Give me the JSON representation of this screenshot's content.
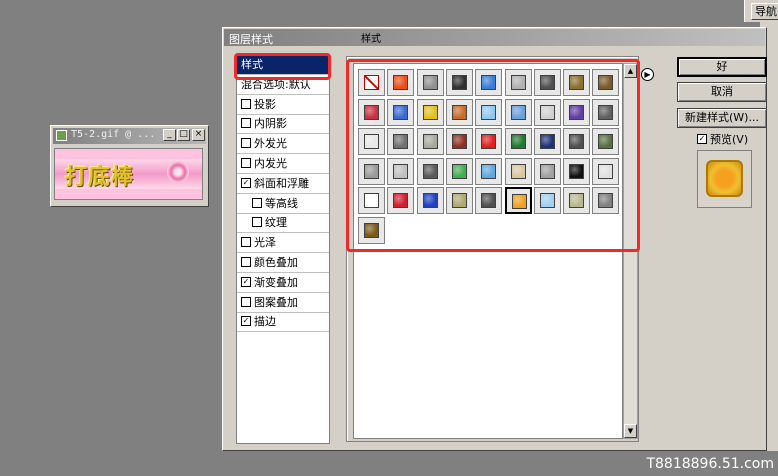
{
  "nav": {
    "tab_label": "导航"
  },
  "doc_window": {
    "title": "T5-2.gif @ ...",
    "canvas_text": "打底棒",
    "buttons": {
      "minimize": "_",
      "maximize": "□",
      "close": "×"
    }
  },
  "dialog": {
    "title": "图层样式",
    "styles_label": "样式",
    "effects": [
      {
        "label": "样式",
        "selected": true,
        "checkbox": false,
        "checked": false,
        "sub": false
      },
      {
        "label": "混合选项:默认",
        "selected": false,
        "checkbox": false,
        "checked": false,
        "sub": false
      },
      {
        "label": "投影",
        "selected": false,
        "checkbox": true,
        "checked": false,
        "sub": false
      },
      {
        "label": "内阴影",
        "selected": false,
        "checkbox": true,
        "checked": false,
        "sub": false
      },
      {
        "label": "外发光",
        "selected": false,
        "checkbox": true,
        "checked": false,
        "sub": false
      },
      {
        "label": "内发光",
        "selected": false,
        "checkbox": true,
        "checked": false,
        "sub": false
      },
      {
        "label": "斜面和浮雕",
        "selected": false,
        "checkbox": true,
        "checked": true,
        "sub": false
      },
      {
        "label": "等高线",
        "selected": false,
        "checkbox": true,
        "checked": false,
        "sub": true
      },
      {
        "label": "纹理",
        "selected": false,
        "checkbox": true,
        "checked": false,
        "sub": true
      },
      {
        "label": "光泽",
        "selected": false,
        "checkbox": true,
        "checked": false,
        "sub": false
      },
      {
        "label": "颜色叠加",
        "selected": false,
        "checkbox": true,
        "checked": false,
        "sub": false
      },
      {
        "label": "渐变叠加",
        "selected": false,
        "checkbox": true,
        "checked": true,
        "sub": false
      },
      {
        "label": "图案叠加",
        "selected": false,
        "checkbox": true,
        "checked": false,
        "sub": false
      },
      {
        "label": "描边",
        "selected": false,
        "checkbox": true,
        "checked": true,
        "sub": false
      }
    ],
    "swatches": [
      {
        "name": "none-style-swatch",
        "fill": "#ffffff",
        "border": "#c00000",
        "none": true
      },
      {
        "name": "orange-glow-swatch",
        "fill": "#e8501a"
      },
      {
        "name": "gray-bevel-swatch",
        "fill": "#909090"
      },
      {
        "name": "black-chrome-swatch",
        "fill": "#303030"
      },
      {
        "name": "blue-glass-swatch",
        "fill": "#3a7ed8"
      },
      {
        "name": "silver-swatch",
        "fill": "#b0b0b0"
      },
      {
        "name": "dark-metal-swatch",
        "fill": "#505050"
      },
      {
        "name": "olive-swatch",
        "fill": "#8a7030"
      },
      {
        "name": "bronze-swatch",
        "fill": "#7a5a28"
      },
      {
        "name": "red-bevel-swatch",
        "fill": "#c83040"
      },
      {
        "name": "multicolor-swatch",
        "fill": "#3a6ad0"
      },
      {
        "name": "yellow-button-swatch",
        "fill": "#e0c020"
      },
      {
        "name": "copper-swatch",
        "fill": "#c86a28"
      },
      {
        "name": "sky-swatch",
        "fill": "#90c8f0"
      },
      {
        "name": "landscape-swatch",
        "fill": "#6aa0d8"
      },
      {
        "name": "noise-swatch",
        "fill": "#d0d0d0"
      },
      {
        "name": "purple-swatch",
        "fill": "#6040a0"
      },
      {
        "name": "dark-gray-swatch",
        "fill": "#606060"
      },
      {
        "name": "light-bevel-swatch",
        "fill": "#e8e8e8"
      },
      {
        "name": "slate-swatch",
        "fill": "#707070"
      },
      {
        "name": "stone-swatch",
        "fill": "#a8a8a0"
      },
      {
        "name": "rust-swatch",
        "fill": "#903020"
      },
      {
        "name": "bright-red-swatch",
        "fill": "#e02020"
      },
      {
        "name": "green-swatch",
        "fill": "#207a30"
      },
      {
        "name": "navy-swatch",
        "fill": "#20307a"
      },
      {
        "name": "checker-swatch",
        "fill": "#505050"
      },
      {
        "name": "moss-swatch",
        "fill": "#5a7040"
      },
      {
        "name": "pewter-swatch",
        "fill": "#9a9a9a"
      },
      {
        "name": "barcode-swatch",
        "fill": "#c0c0c0"
      },
      {
        "name": "graphite-swatch",
        "fill": "#5a5a5a"
      },
      {
        "name": "emerald-swatch",
        "fill": "#40b050"
      },
      {
        "name": "aqua-swatch",
        "fill": "#60a8e0"
      },
      {
        "name": "sand-swatch",
        "fill": "#d8c8a0"
      },
      {
        "name": "ash-swatch",
        "fill": "#a0a0a0"
      },
      {
        "name": "black-swatch",
        "fill": "#101010"
      },
      {
        "name": "sketch-swatch",
        "fill": "#e0e0e0"
      },
      {
        "name": "white-outline-swatch",
        "fill": "#ffffff"
      },
      {
        "name": "crimson-swatch",
        "fill": "#d02030"
      },
      {
        "name": "cobalt-swatch",
        "fill": "#2040c0"
      },
      {
        "name": "khaki-swatch",
        "fill": "#b0a870"
      },
      {
        "name": "charcoal-swatch",
        "fill": "#505050"
      },
      {
        "name": "gold-orange-swatch",
        "fill": "#f0a020"
      },
      {
        "name": "ice-swatch",
        "fill": "#a0d0f0"
      },
      {
        "name": "sage-swatch",
        "fill": "#b8b890"
      },
      {
        "name": "pattern-swatch",
        "fill": "#808080"
      },
      {
        "name": "brown-gold-swatch",
        "fill": "#7a5a18"
      }
    ],
    "selected_swatch_index": 41,
    "buttons": {
      "ok": "好",
      "cancel": "取消",
      "new_style": "新建样式(W)...",
      "preview": "预览(V)"
    },
    "preview_checked": true
  },
  "watermark": "T8818896.51.com",
  "colors": {
    "annotation_red": "#ee2a2a",
    "selection_blue": "#0a246a",
    "dialog_face": "#d4d0c8",
    "desktop": "#808080"
  }
}
